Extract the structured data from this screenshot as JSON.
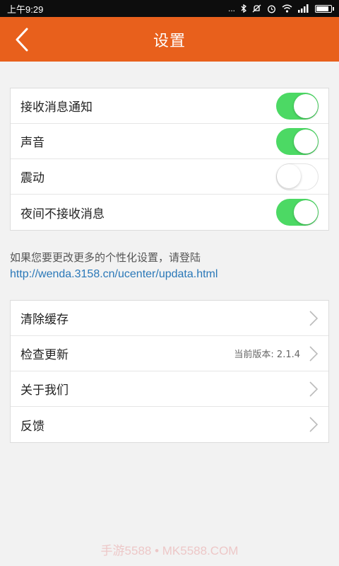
{
  "status_bar": {
    "time": "上午9:29",
    "dots": "...",
    "icons": [
      "bluetooth-icon",
      "mute-icon",
      "alarm-icon",
      "wifi-icon",
      "signal-icon",
      "battery-icon"
    ]
  },
  "navbar": {
    "title": "设置",
    "color": "#e8601c"
  },
  "notification_settings": [
    {
      "label": "接收消息通知",
      "on": true
    },
    {
      "label": "声音",
      "on": true
    },
    {
      "label": "震动",
      "on": false
    },
    {
      "label": "夜间不接收消息",
      "on": true
    }
  ],
  "hint": {
    "text": "如果您要更改更多的个性化设置，请登陆",
    "link": "http://wenda.3158.cn/ucenter/updata.html"
  },
  "menu": {
    "clear_cache": "清除缓存",
    "check_update": "检查更新",
    "version_text": "当前版本: 2.1.4",
    "about": "关于我们",
    "feedback": "反馈"
  },
  "watermark": "手游5588 • MK5588.COM",
  "colors": {
    "toggle_on": "#4cd964",
    "link": "#2a78b8"
  }
}
